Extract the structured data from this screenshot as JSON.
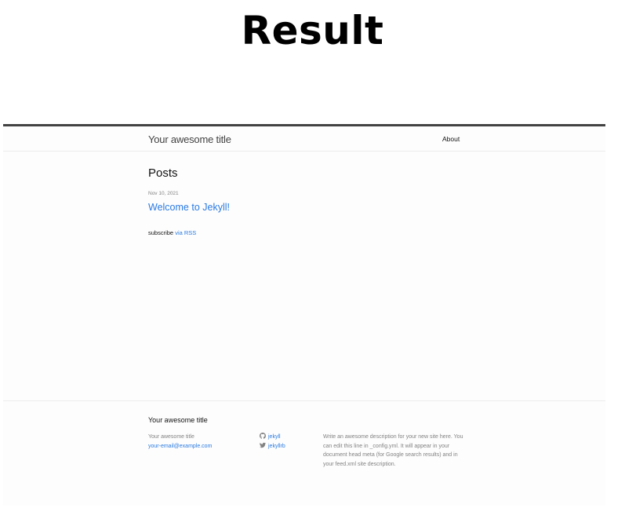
{
  "heading": "Result",
  "header": {
    "site_title": "Your awesome title",
    "nav": [
      "About"
    ]
  },
  "main": {
    "posts_heading": "Posts",
    "posts": [
      {
        "date": "Nov 10, 2021",
        "title": "Welcome to Jekyll!"
      }
    ],
    "subscribe_label": "subscribe",
    "rss_link": "via RSS"
  },
  "footer": {
    "heading": "Your awesome title",
    "contact_name": "Your awesome title",
    "email": "your-email@example.com",
    "social": [
      {
        "icon": "github-icon",
        "label": "jekyll"
      },
      {
        "icon": "twitter-icon",
        "label": "jekyllrb"
      }
    ],
    "description": "Write an awesome description for your new site here. You can edit this line in _config.yml. It will appear in your document head meta (for Google search results) and in your feed.xml site description."
  },
  "colors": {
    "link": "#2a7ae2",
    "muted": "#828282",
    "header_border": "#424242",
    "page_bg": "#fdfdfd"
  }
}
